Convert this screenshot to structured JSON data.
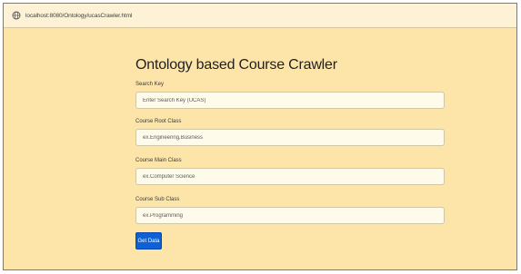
{
  "browser": {
    "url": "localhost:8080/Ontology/ucasCrawler.html"
  },
  "page": {
    "title": "Ontology based Course Crawler"
  },
  "form": {
    "search_key": {
      "label": "Search Key",
      "placeholder": "Enter Search Key (UCAS)"
    },
    "root_class": {
      "label": "Course Root Class",
      "placeholder": "ex.Engineering,Business"
    },
    "main_class": {
      "label": "Course Main Class",
      "placeholder": "ex.Computer Science"
    },
    "sub_class": {
      "label": "Course Sub Class",
      "placeholder": "ex.Programming"
    },
    "submit_label": "Get Data"
  },
  "colors": {
    "page_background": "#fde5a9",
    "button": "#0c61d8"
  },
  "icons": {
    "address_bar": "globe-icon"
  }
}
